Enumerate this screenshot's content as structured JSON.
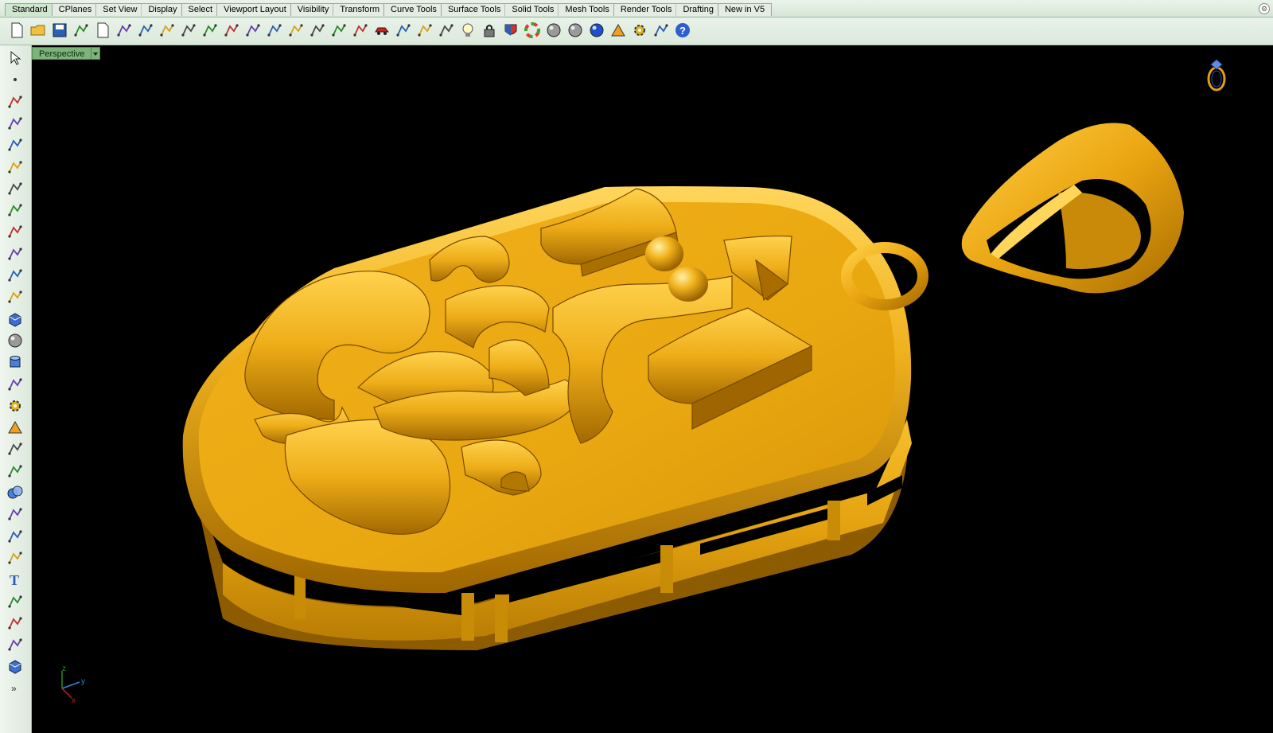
{
  "tabs": [
    "Standard",
    "CPlanes",
    "Set View",
    "Display",
    "Select",
    "Viewport Layout",
    "Visibility",
    "Transform",
    "Curve Tools",
    "Surface Tools",
    "Solid Tools",
    "Mesh Tools",
    "Render Tools",
    "Drafting",
    "New in V5"
  ],
  "active_tab": "Standard",
  "viewport": {
    "label": "Perspective"
  },
  "axes": {
    "z": "z",
    "y": "y",
    "x": "x"
  },
  "colors": {
    "gold": "#e9a912",
    "gold_dark": "#a56d00",
    "gold_light": "#ffd35a",
    "viewport_bg": "#000000",
    "ui_green": "#dbe9db"
  },
  "toolbar_icons": [
    "new-file-icon",
    "open-folder-icon",
    "save-icon",
    "print-icon",
    "import-icon",
    "cut-icon",
    "copy-icon",
    "paste-icon",
    "undo-icon",
    "pan-hand-icon",
    "move-cross-icon",
    "zoom-icon",
    "zoom-window-icon",
    "zoom-extents-icon",
    "zoom-selected-icon",
    "rotate-view-icon",
    "four-viewports-icon",
    "car-icon",
    "named-views-icon",
    "cplane-icon",
    "snap-icon",
    "light-bulb-icon",
    "lock-icon",
    "layer-shield-icon",
    "color-wheel-icon",
    "shaded-sphere-icon",
    "rendered-sphere-icon",
    "blue-sphere-icon",
    "render-tools-icon",
    "options-gear-icon",
    "split-view-icon",
    "help-icon"
  ],
  "left_icons": [
    "select-arrow-icon",
    "point-icon",
    "polyline-icon",
    "curve-points-icon",
    "circle-icon",
    "arc-icon",
    "curve-icon",
    "rectangle-icon",
    "polygon-icon",
    "fillet-curve-icon",
    "surface-icon",
    "extrude-icon",
    "box-icon",
    "spheres-icon",
    "cylinder-icon",
    "plane-surface-icon",
    "gear-solid-icon",
    "analyze-icon",
    "dimension-icon",
    "hatch-icon",
    "boolean-icon",
    "points-icon",
    "curve-tools-icon",
    "offset-icon",
    "text-icon",
    "transform-icon",
    "array-icon",
    "flow-icon",
    "box-edit-icon",
    "more-icon"
  ]
}
